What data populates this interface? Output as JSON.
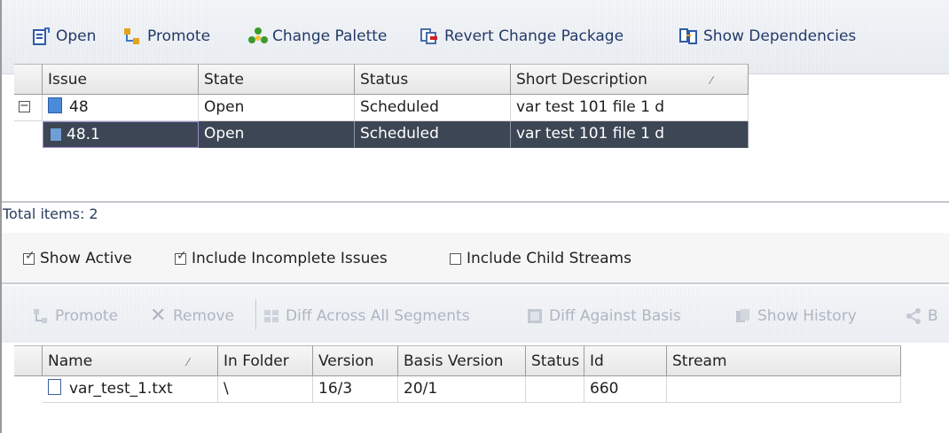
{
  "toolbar": {
    "open": "Open",
    "promote": "Promote",
    "change_palette": "Change Palette",
    "revert": "Revert Change Package",
    "show_dependencies": "Show Dependencies"
  },
  "issues_table": {
    "columns": [
      "Issue",
      "State",
      "Status",
      "Short Description"
    ],
    "rows": [
      {
        "issue": "48",
        "state": "Open",
        "status": "Scheduled",
        "desc": "var test 101 file 1 d",
        "expander": "−"
      },
      {
        "issue": "48.1",
        "state": "Open",
        "status": "Scheduled",
        "desc": "var test 101 file 1 d"
      }
    ],
    "sort_marker": "⁄"
  },
  "total_items": "Total items: 2",
  "filters": {
    "show_active": "Show Active",
    "show_active_checked": true,
    "include_incomplete": "Include Incomplete Issues",
    "include_incomplete_checked": true,
    "include_child": "Include Child Streams",
    "include_child_checked": false
  },
  "toolbar2": {
    "promote": "Promote",
    "remove": "Remove",
    "diff_all": "Diff Across All Segments",
    "diff_basis": "Diff Against Basis",
    "show_history": "Show History",
    "overflow": "B"
  },
  "files_table": {
    "columns": [
      "Name",
      "In Folder",
      "Version",
      "Basis Version",
      "Status",
      "Id",
      "Stream"
    ],
    "rows": [
      {
        "name": "var_test_1.txt",
        "folder": "\\",
        "version": "16/3",
        "basis": "20/1",
        "status": "",
        "id": "660",
        "stream": ""
      }
    ],
    "sort_marker": "⁄"
  },
  "colors": {
    "selection": "#3d4654",
    "toolbar_text": "#223a68",
    "disabled_text": "#aeb6c2"
  }
}
